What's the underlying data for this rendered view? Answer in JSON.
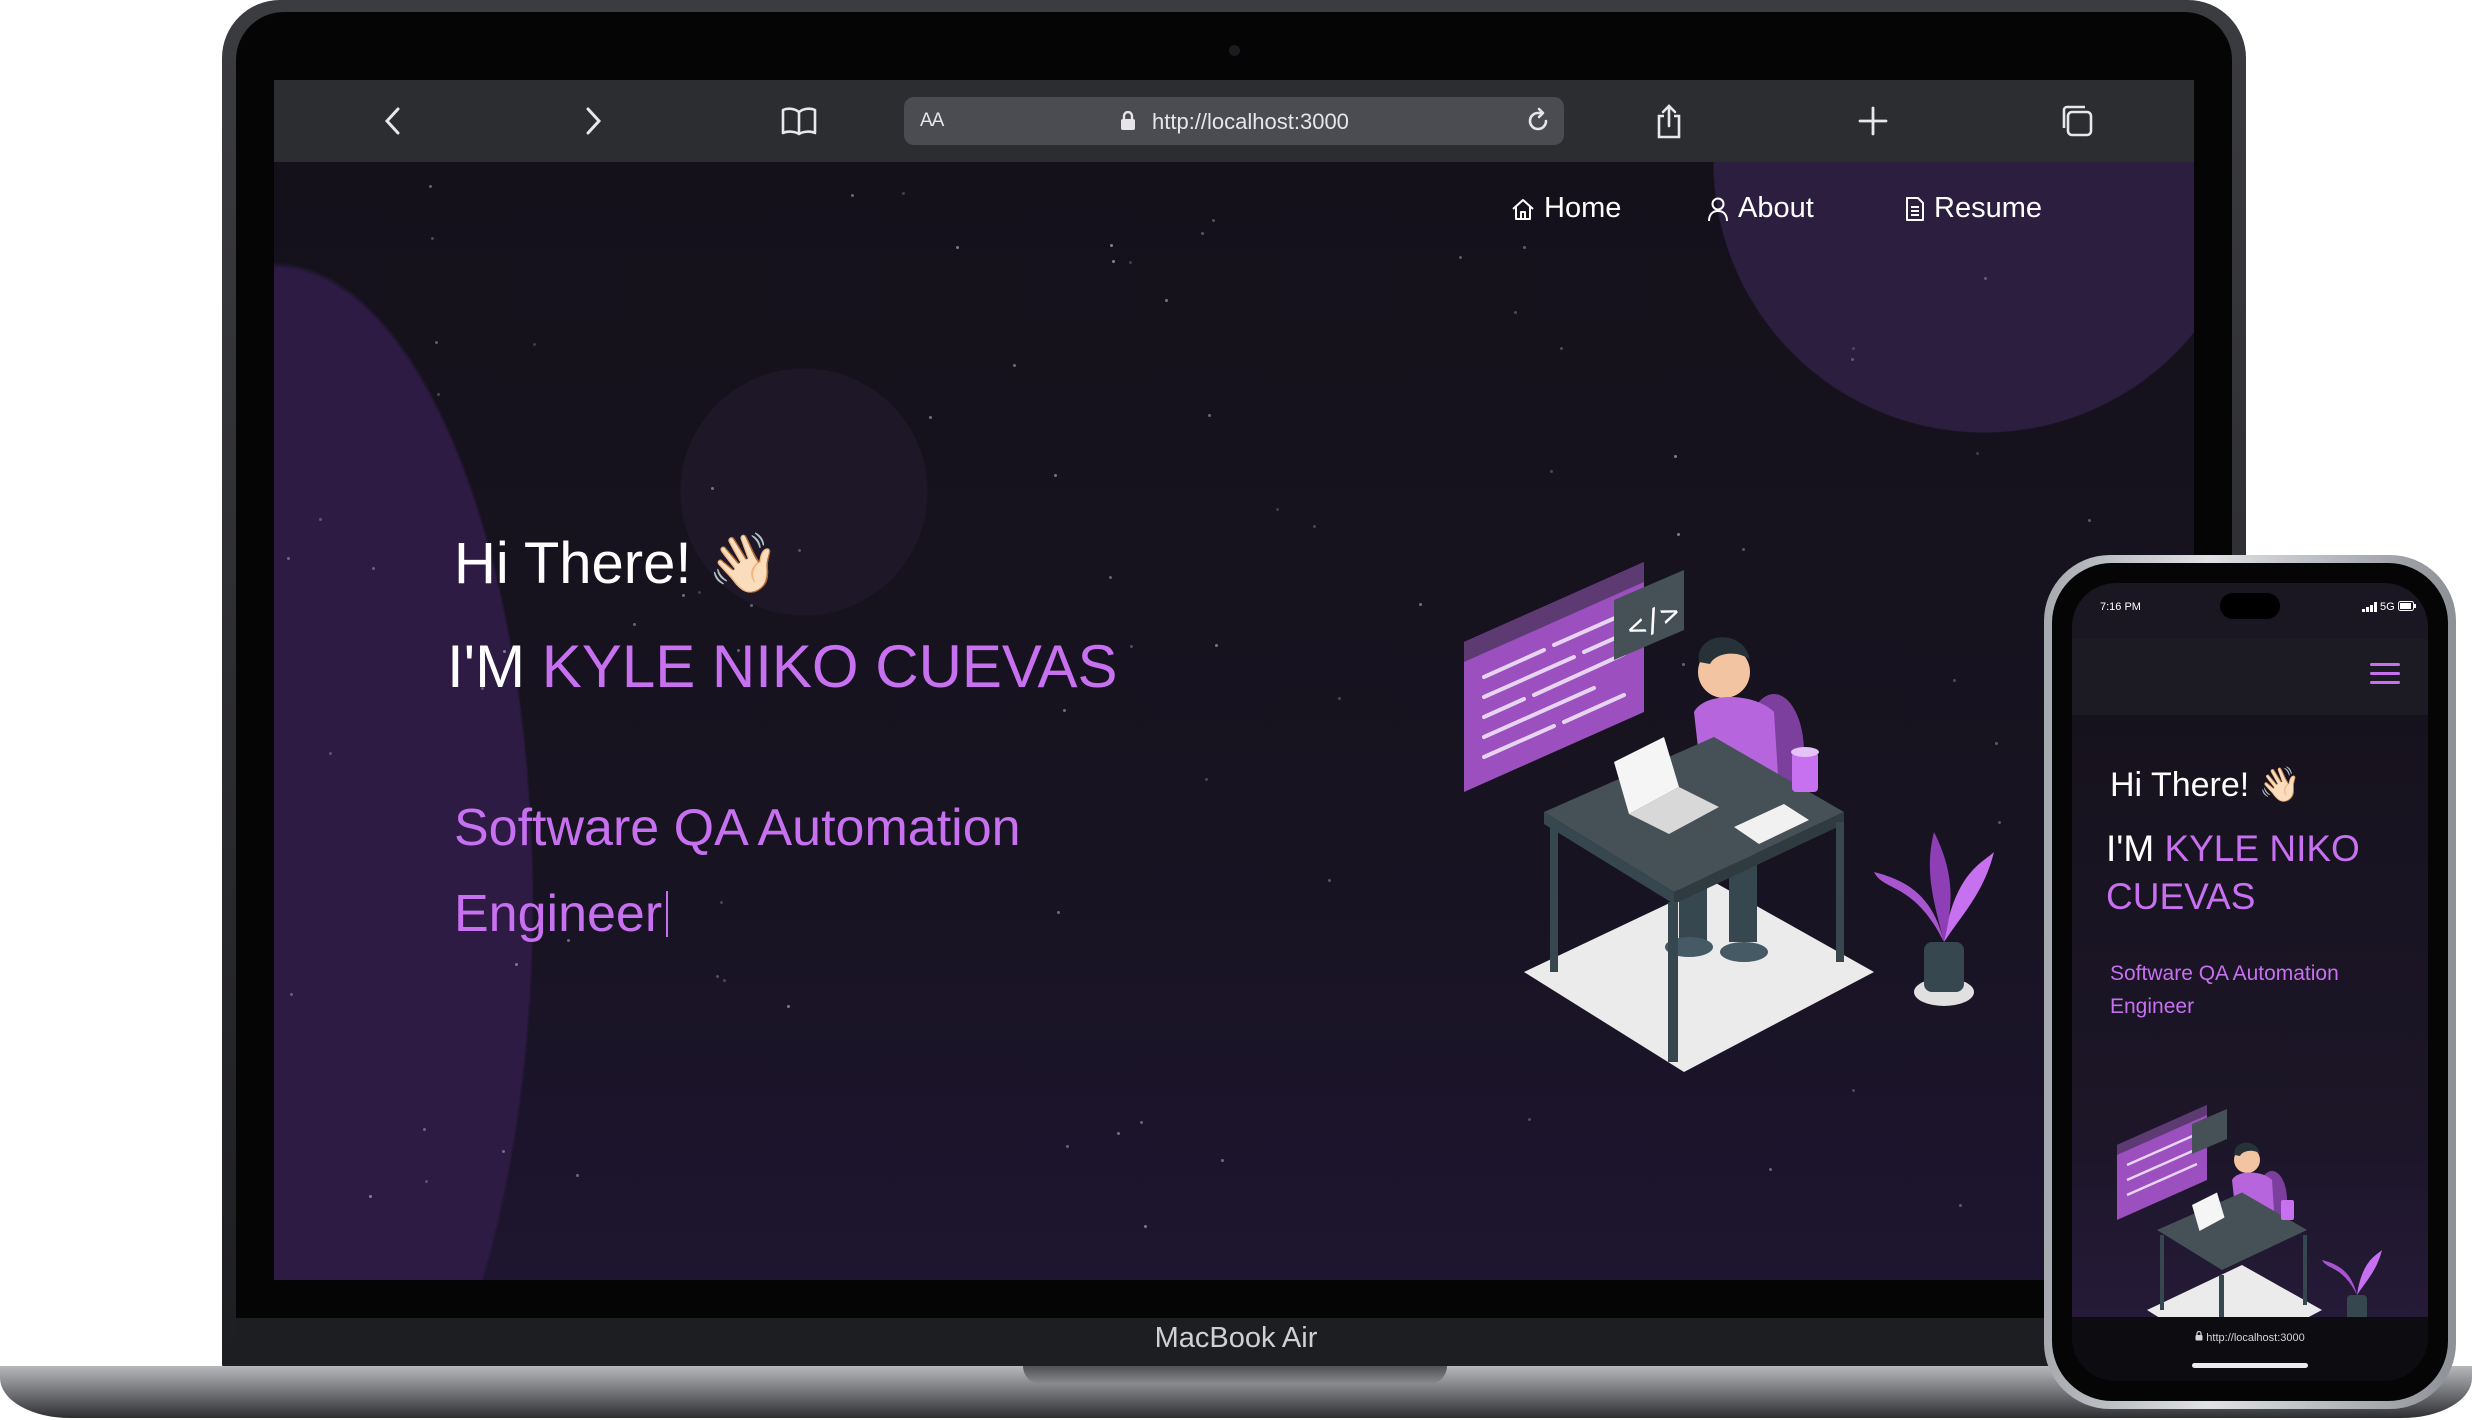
{
  "device": {
    "brand": "MacBook Air"
  },
  "browser": {
    "text_size_label": "AA",
    "url": "http://localhost:3000"
  },
  "nav": {
    "items": [
      {
        "label": "Home",
        "icon": "home-icon"
      },
      {
        "label": "About",
        "icon": "user-icon"
      },
      {
        "label": "Resume",
        "icon": "document-icon"
      }
    ]
  },
  "hero": {
    "greeting": "Hi There!",
    "greeting_emoji": "👋🏻",
    "intro_prefix": "I'M",
    "name": "KYLE NIKO CUEVAS",
    "role": "Software QA Automation Engineer",
    "illustration": "developer-at-desk-illustration"
  },
  "phone": {
    "time": "7:16 PM",
    "network": "5G",
    "url": "http://localhost:3000",
    "menu_icon": "hamburger-icon"
  },
  "colors": {
    "accent": "#c770f0",
    "background": "#15121b",
    "toolbar": "#2b2d30"
  }
}
